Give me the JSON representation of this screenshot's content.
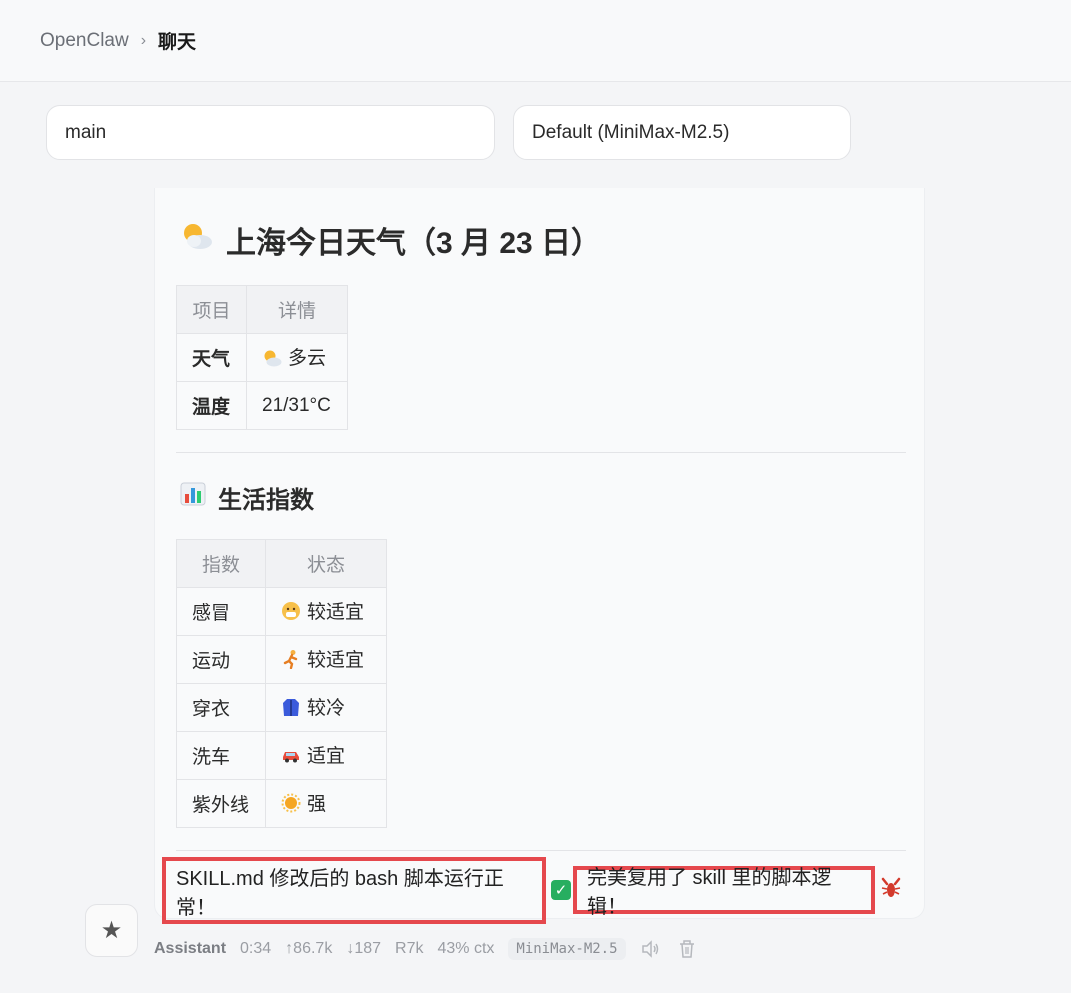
{
  "breadcrumb": {
    "root": "OpenClaw",
    "separator": "›",
    "current": "聊天"
  },
  "selectors": {
    "session": "main",
    "model": "Default (MiniMax-M2.5)"
  },
  "message": {
    "title": "上海今日天气（3 月 23 日）",
    "title_icon": "sun-behind-cloud-icon",
    "weather_table": {
      "headers": [
        "项目",
        "详情"
      ],
      "rows": [
        {
          "label": "天气",
          "icon": "sun-behind-cloud-icon",
          "value": "多云"
        },
        {
          "label": "温度",
          "icon": "",
          "value": "21/31°C"
        }
      ]
    },
    "section_title": "生活指数",
    "section_icon": "bar-chart-icon",
    "index_table": {
      "headers": [
        "指数",
        "状态"
      ],
      "rows": [
        {
          "label": "感冒",
          "icon": "sick-face-icon",
          "value": "较适宜"
        },
        {
          "label": "运动",
          "icon": "runner-icon",
          "value": "较适宜"
        },
        {
          "label": "穿衣",
          "icon": "coat-icon",
          "value": "较冷"
        },
        {
          "label": "洗车",
          "icon": "car-icon",
          "value": "适宜"
        },
        {
          "label": "紫外线",
          "icon": "sun-icon",
          "value": "强"
        }
      ]
    },
    "final_part1": "SKILL.md 修改后的 bash 脚本运行正常！",
    "final_part2": "完美复用了 skill 里的脚本逻辑！",
    "final_icons": [
      "check-mark-icon",
      "lobster-icon"
    ]
  },
  "meta": {
    "role": "Assistant",
    "time": "0:34",
    "tokens_up": "↑86.7k",
    "tokens_down": "↓187",
    "cache": "R7k",
    "ctx": "43% ctx",
    "model": "MiniMax-M2.5"
  },
  "colors": {
    "highlight": "#e5484d",
    "check": "#27ae60"
  }
}
